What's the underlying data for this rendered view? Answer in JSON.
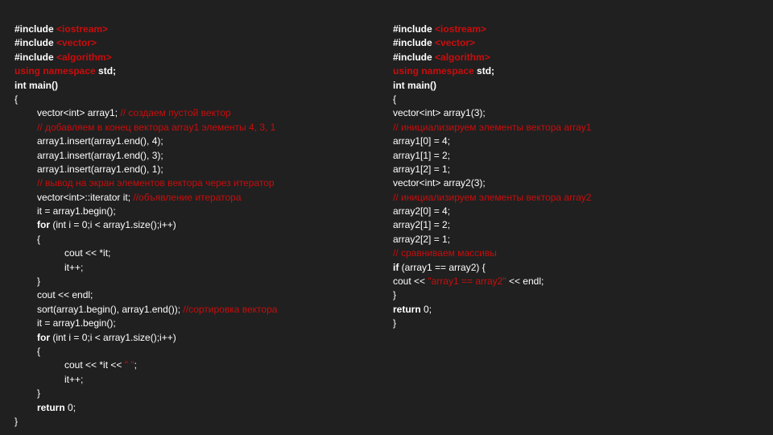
{
  "left": {
    "l1a": "#include ",
    "l1b": "<iostream>",
    "l2a": "#include ",
    "l2b": "<vector>",
    "l3a": "#include ",
    "l3b": "<algorithm>",
    "l4a": "using namespace ",
    "l4b": "std;",
    "l5a": "int main",
    "l5b": "()",
    "l6": "{",
    "l7a": "vector<int> array1; ",
    "l7b": "// создаем пустой вектор",
    "l8": "// добавляем в конец вектора array1 элементы 4, 3, 1",
    "l9": "array1.insert(array1.end(), 4);",
    "l10": "array1.insert(array1.end(), 3);",
    "l11": "array1.insert(array1.end(), 1);",
    "l12": "// вывод на экран элементов вектора через итератор",
    "l13a": "vector<int>::iterator it; ",
    "l13b": "//объявление итератора",
    "l14": "it = array1.begin();",
    "l15a": "for ",
    "l15b": "(int i = 0;i < array1.size();i++)",
    "l16": "{",
    "l17": "cout << *it;",
    "l18": "it++;",
    "l19": "}",
    "l20": "cout << endl;",
    "l21a": "sort(array1.begin(), array1.end()); ",
    "l21b": "//сортировка вектора",
    "l22": "it = array1.begin();",
    "l23a": "for ",
    "l23b": "(int i = 0;i < array1.size();i++)",
    "l24": "{",
    "l25a": "cout << *it << ",
    "l25b": "\" \"",
    "l25c": ";",
    "l26": "it++;",
    "l27": "}",
    "l28a": "return ",
    "l28b": "0;",
    "l29": "}"
  },
  "right": {
    "l1a": "#include ",
    "l1b": "<iostream>",
    "l2a": "#include ",
    "l2b": "<vector>",
    "l3a": "#include ",
    "l3b": "<algorithm>",
    "l4a": "using namespace ",
    "l4b": "std;",
    "l5a": "int main",
    "l5b": "()",
    "l6": "{",
    "l7": "vector<int> array1(3);",
    "l8": "// инициализируем элементы вектора array1",
    "l9": "array1[0] = 4;",
    "l10": "array1[1] = 2;",
    "l11": "array1[2] = 1;",
    "l12": "vector<int> array2(3);",
    "l13": "// инициализируем элементы вектора array2",
    "l14": "array2[0] = 4;",
    "l15": "array2[1] = 2;",
    "l16": "array2[2] = 1;",
    "l17": "// сравниваем массивы",
    "l18a": "if ",
    "l18b": "(array1 == array2) {",
    "l19a": "cout << ",
    "l19b": "\"array1 == array2\"",
    "l19c": " << endl;",
    "l20": "}",
    "l21a": "return ",
    "l21b": "0;",
    "l22": "}"
  }
}
